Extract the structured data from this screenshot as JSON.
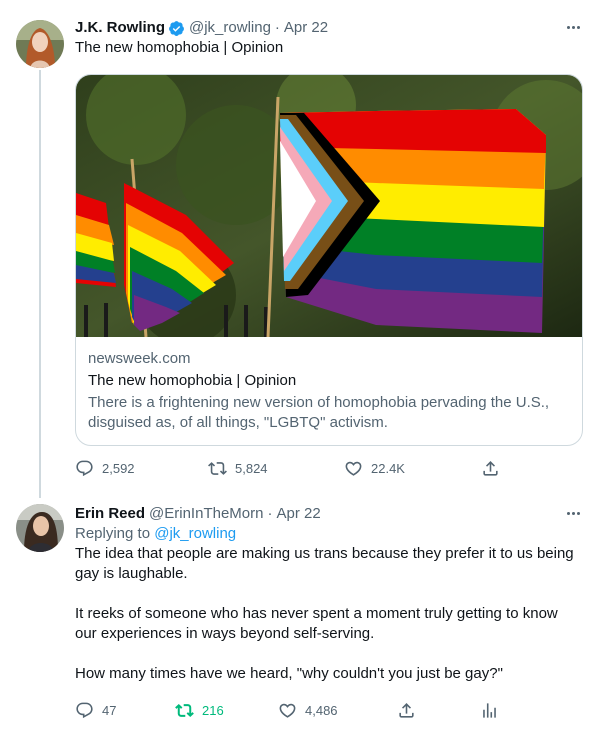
{
  "tweet1": {
    "name": "J.K. Rowling",
    "handle": "@jk_rowling",
    "separator": "·",
    "date": "Apr 22",
    "text": "The new homophobia | Opinion",
    "card": {
      "domain": "newsweek.com",
      "title": "The new homophobia | Opinion",
      "description": "There is a frightening new version of homophobia pervading the U.S., disguised as, of all things, \"LGBTQ\" activism."
    },
    "actions": {
      "replies": "2,592",
      "retweets": "5,824",
      "likes": "22.4K"
    }
  },
  "tweet2": {
    "name": "Erin Reed",
    "handle": "@ErinInTheMorn",
    "separator": "·",
    "date": "Apr 22",
    "replying_prefix": "Replying to",
    "replying_to": "@jk_rowling",
    "paragraphs": [
      "The idea that people are making us trans because they prefer it to us being gay is laughable.",
      "It reeks of someone who has never spent a moment truly getting to know our experiences in ways beyond self-serving.",
      "How many times have we heard, \"why couldn't you just be gay?\""
    ],
    "actions": {
      "replies": "47",
      "retweets": "216",
      "likes": "4,486"
    }
  },
  "colors": {
    "accent": "#1d9bf0",
    "retweet_active": "#00ba7c",
    "muted": "#536471",
    "border": "#cfd9de"
  },
  "icons": [
    "verified-badge-icon",
    "more-icon",
    "reply-icon",
    "retweet-icon",
    "like-icon",
    "share-icon",
    "analytics-icon"
  ]
}
